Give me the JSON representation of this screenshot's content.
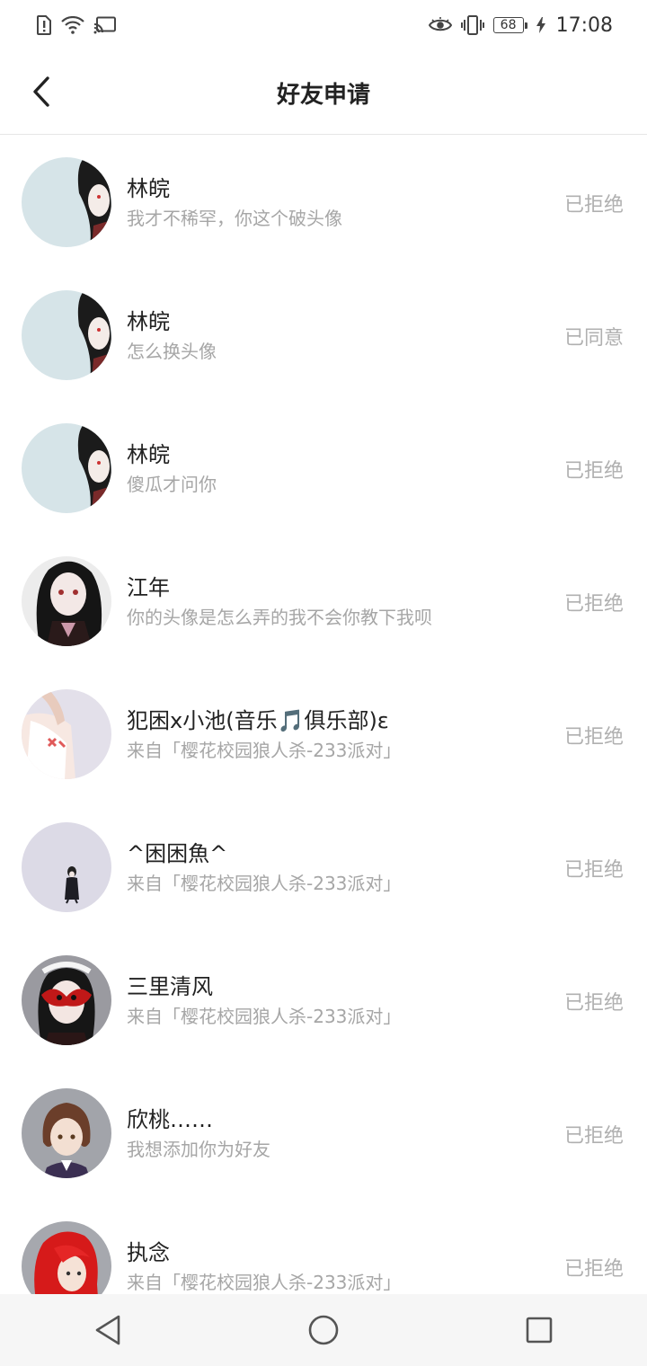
{
  "status_bar": {
    "time": "17:08",
    "battery": "68",
    "icons": [
      "sim-alert-icon",
      "wifi-icon",
      "cast-icon",
      "eye-comfort-icon",
      "vibrate-icon",
      "battery-icon",
      "charging-icon"
    ]
  },
  "header": {
    "title": "好友申请",
    "back_icon": "chevron-left-icon"
  },
  "requests": [
    {
      "name": "林皖",
      "message": "我才不稀罕，你这个破头像",
      "status": "已拒绝",
      "avatar_bg": "#d6e4e8"
    },
    {
      "name": "林皖",
      "message": "怎么换头像",
      "status": "已同意",
      "avatar_bg": "#d6e4e8"
    },
    {
      "name": "林皖",
      "message": "傻瓜才问你",
      "status": "已拒绝",
      "avatar_bg": "#d6e4e8"
    },
    {
      "name": "江年",
      "message": "你的头像是怎么弄的我不会你教下我呗",
      "status": "已拒绝",
      "avatar_bg": "#ececec"
    },
    {
      "name": "犯困x小池(音乐🎵俱乐部)ε",
      "message": "来自「樱花校园狼人杀-233派对」",
      "status": "已拒绝",
      "avatar_bg": "#e3e0ea"
    },
    {
      "name": "^困困魚^",
      "message": "来自「樱花校园狼人杀-233派对」",
      "status": "已拒绝",
      "avatar_bg": "#dcdae6"
    },
    {
      "name": "三里清风",
      "message": "来自「樱花校园狼人杀-233派对」",
      "status": "已拒绝",
      "avatar_bg": "#9a9aa0"
    },
    {
      "name": "欣桃……",
      "message": "我想添加你为好友",
      "status": "已拒绝",
      "avatar_bg": "#a2a4aa"
    },
    {
      "name": "执念",
      "message": "来自「樱花校园狼人杀-233派对」",
      "status": "已拒绝",
      "avatar_bg": "#a6a8ae"
    }
  ],
  "nav_bar": {
    "icons": [
      "back-triangle-icon",
      "home-circle-icon",
      "recents-square-icon"
    ]
  }
}
